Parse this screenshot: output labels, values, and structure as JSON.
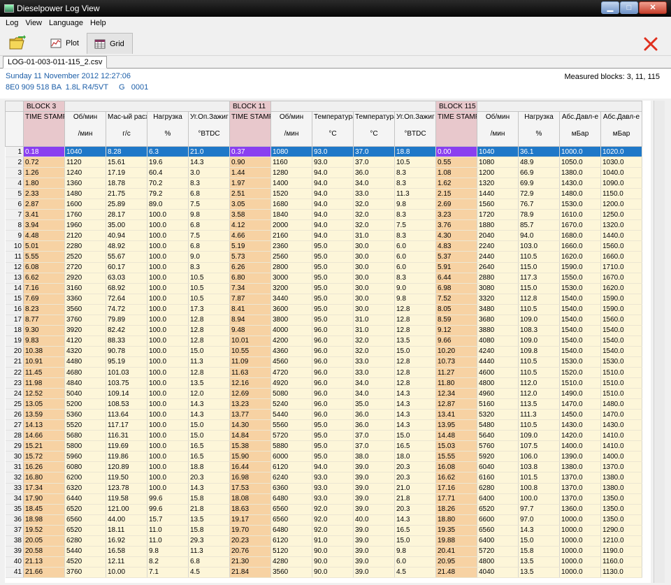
{
  "window": {
    "title": "Dieselpower Log View",
    "min": "▁",
    "max": "□",
    "close": "✕"
  },
  "menu": [
    "Log",
    "View",
    "Language",
    "Help"
  ],
  "toolbar": {
    "plot_label": "Plot",
    "grid_label": "Grid"
  },
  "file_tab": "LOG-01-003-011-115_2.csv",
  "info": {
    "date": "Sunday 11 November 2012 12:27:06",
    "ecu": "8E0 909 518 BA  1.8L R4/5VT     G   0001",
    "measured": "Measured blocks: 3, 11, 115"
  },
  "blocks": [
    {
      "label": "BLOCK 3",
      "span": 5
    },
    {
      "label": "BLOCK 11",
      "span": 5
    },
    {
      "label": "BLOCK 115",
      "span": 5
    }
  ],
  "columns": [
    {
      "name": "TIME STAMP",
      "unit": "",
      "ts": true
    },
    {
      "name": "Об/мин",
      "unit": "/мин"
    },
    {
      "name": "Мас-ый расход",
      "unit": "г/с"
    },
    {
      "name": "Нагрузка",
      "unit": "%"
    },
    {
      "name": "Уг.Оп.Зажиг",
      "unit": "°BTDC"
    },
    {
      "name": "TIME STAMP",
      "unit": "",
      "ts": true
    },
    {
      "name": "Об/мин",
      "unit": "/мин"
    },
    {
      "name": "Температура",
      "unit": "°C"
    },
    {
      "name": "Температура",
      "unit": "°C"
    },
    {
      "name": "Уг.Оп.Зажиг",
      "unit": "°BTDC"
    },
    {
      "name": "TIME STAMP",
      "unit": "",
      "ts": true
    },
    {
      "name": "Об/мин",
      "unit": "/мин"
    },
    {
      "name": "Нагрузка",
      "unit": "%"
    },
    {
      "name": "Абс.Давл-е",
      "unit": "мБар"
    },
    {
      "name": "Абс.Давл-е",
      "unit": "мБар"
    }
  ],
  "selected_row": 1,
  "rows": [
    [
      "1",
      "0.18",
      "1040",
      "8.28",
      "6.3",
      "21.0",
      "0.37",
      "1080",
      "93.0",
      "37.0",
      "18.8",
      "0.00",
      "1040",
      "36.1",
      "1000.0",
      "1020.0"
    ],
    [
      "2",
      "0.72",
      "1120",
      "15.61",
      "19.6",
      "14.3",
      "0.90",
      "1160",
      "93.0",
      "37.0",
      "10.5",
      "0.55",
      "1080",
      "48.9",
      "1050.0",
      "1030.0"
    ],
    [
      "3",
      "1.26",
      "1240",
      "17.19",
      "60.4",
      "3.0",
      "1.44",
      "1280",
      "94.0",
      "36.0",
      "8.3",
      "1.08",
      "1200",
      "66.9",
      "1380.0",
      "1040.0"
    ],
    [
      "4",
      "1.80",
      "1360",
      "18.78",
      "70.2",
      "8.3",
      "1.97",
      "1400",
      "94.0",
      "34.0",
      "8.3",
      "1.62",
      "1320",
      "69.9",
      "1430.0",
      "1090.0"
    ],
    [
      "5",
      "2.33",
      "1480",
      "21.75",
      "79.2",
      "6.8",
      "2.51",
      "1520",
      "94.0",
      "33.0",
      "11.3",
      "2.15",
      "1440",
      "72.9",
      "1480.0",
      "1150.0"
    ],
    [
      "6",
      "2.87",
      "1600",
      "25.89",
      "89.0",
      "7.5",
      "3.05",
      "1680",
      "94.0",
      "32.0",
      "9.8",
      "2.69",
      "1560",
      "76.7",
      "1530.0",
      "1200.0"
    ],
    [
      "7",
      "3.41",
      "1760",
      "28.17",
      "100.0",
      "9.8",
      "3.58",
      "1840",
      "94.0",
      "32.0",
      "8.3",
      "3.23",
      "1720",
      "78.9",
      "1610.0",
      "1250.0"
    ],
    [
      "8",
      "3.94",
      "1960",
      "35.00",
      "100.0",
      "6.8",
      "4.12",
      "2000",
      "94.0",
      "32.0",
      "7.5",
      "3.76",
      "1880",
      "85.7",
      "1670.0",
      "1320.0"
    ],
    [
      "9",
      "4.48",
      "2120",
      "40.94",
      "100.0",
      "7.5",
      "4.66",
      "2160",
      "94.0",
      "31.0",
      "8.3",
      "4.30",
      "2040",
      "94.0",
      "1680.0",
      "1440.0"
    ],
    [
      "10",
      "5.01",
      "2280",
      "48.92",
      "100.0",
      "6.8",
      "5.19",
      "2360",
      "95.0",
      "30.0",
      "6.0",
      "4.83",
      "2240",
      "103.0",
      "1660.0",
      "1560.0"
    ],
    [
      "11",
      "5.55",
      "2520",
      "55.67",
      "100.0",
      "9.0",
      "5.73",
      "2560",
      "95.0",
      "30.0",
      "6.0",
      "5.37",
      "2440",
      "110.5",
      "1620.0",
      "1660.0"
    ],
    [
      "12",
      "6.08",
      "2720",
      "60.17",
      "100.0",
      "8.3",
      "6.26",
      "2800",
      "95.0",
      "30.0",
      "6.0",
      "5.91",
      "2640",
      "115.0",
      "1590.0",
      "1710.0"
    ],
    [
      "13",
      "6.62",
      "2920",
      "63.03",
      "100.0",
      "10.5",
      "6.80",
      "3000",
      "95.0",
      "30.0",
      "8.3",
      "6.44",
      "2880",
      "117.3",
      "1550.0",
      "1670.0"
    ],
    [
      "14",
      "7.16",
      "3160",
      "68.92",
      "100.0",
      "10.5",
      "7.34",
      "3200",
      "95.0",
      "30.0",
      "9.0",
      "6.98",
      "3080",
      "115.0",
      "1530.0",
      "1620.0"
    ],
    [
      "15",
      "7.69",
      "3360",
      "72.64",
      "100.0",
      "10.5",
      "7.87",
      "3440",
      "95.0",
      "30.0",
      "9.8",
      "7.52",
      "3320",
      "112.8",
      "1540.0",
      "1590.0"
    ],
    [
      "16",
      "8.23",
      "3560",
      "74.72",
      "100.0",
      "17.3",
      "8.41",
      "3600",
      "95.0",
      "30.0",
      "12.8",
      "8.05",
      "3480",
      "110.5",
      "1540.0",
      "1590.0"
    ],
    [
      "17",
      "8.77",
      "3760",
      "79.89",
      "100.0",
      "12.8",
      "8.94",
      "3800",
      "95.0",
      "31.0",
      "12.8",
      "8.59",
      "3680",
      "109.0",
      "1540.0",
      "1560.0"
    ],
    [
      "18",
      "9.30",
      "3920",
      "82.42",
      "100.0",
      "12.8",
      "9.48",
      "4000",
      "96.0",
      "31.0",
      "12.8",
      "9.12",
      "3880",
      "108.3",
      "1540.0",
      "1540.0"
    ],
    [
      "19",
      "9.83",
      "4120",
      "88.33",
      "100.0",
      "12.8",
      "10.01",
      "4200",
      "96.0",
      "32.0",
      "13.5",
      "9.66",
      "4080",
      "109.0",
      "1540.0",
      "1540.0"
    ],
    [
      "20",
      "10.38",
      "4320",
      "90.78",
      "100.0",
      "15.0",
      "10.55",
      "4360",
      "96.0",
      "32.0",
      "15.0",
      "10.20",
      "4240",
      "109.8",
      "1540.0",
      "1540.0"
    ],
    [
      "21",
      "10.91",
      "4480",
      "95.19",
      "100.0",
      "11.3",
      "11.09",
      "4560",
      "96.0",
      "33.0",
      "12.8",
      "10.73",
      "4440",
      "110.5",
      "1530.0",
      "1530.0"
    ],
    [
      "22",
      "11.45",
      "4680",
      "101.03",
      "100.0",
      "12.8",
      "11.63",
      "4720",
      "96.0",
      "33.0",
      "12.8",
      "11.27",
      "4600",
      "110.5",
      "1520.0",
      "1510.0"
    ],
    [
      "23",
      "11.98",
      "4840",
      "103.75",
      "100.0",
      "13.5",
      "12.16",
      "4920",
      "96.0",
      "34.0",
      "12.8",
      "11.80",
      "4800",
      "112.0",
      "1510.0",
      "1510.0"
    ],
    [
      "24",
      "12.52",
      "5040",
      "109.14",
      "100.0",
      "12.0",
      "12.69",
      "5080",
      "96.0",
      "34.0",
      "14.3",
      "12.34",
      "4960",
      "112.0",
      "1490.0",
      "1510.0"
    ],
    [
      "25",
      "13.05",
      "5200",
      "108.53",
      "100.0",
      "14.3",
      "13.23",
      "5240",
      "96.0",
      "35.0",
      "14.3",
      "12.87",
      "5160",
      "113.5",
      "1470.0",
      "1480.0"
    ],
    [
      "26",
      "13.59",
      "5360",
      "113.64",
      "100.0",
      "14.3",
      "13.77",
      "5440",
      "96.0",
      "36.0",
      "14.3",
      "13.41",
      "5320",
      "111.3",
      "1450.0",
      "1470.0"
    ],
    [
      "27",
      "14.13",
      "5520",
      "117.17",
      "100.0",
      "15.0",
      "14.30",
      "5560",
      "95.0",
      "36.0",
      "14.3",
      "13.95",
      "5480",
      "110.5",
      "1430.0",
      "1430.0"
    ],
    [
      "28",
      "14.66",
      "5680",
      "116.31",
      "100.0",
      "15.0",
      "14.84",
      "5720",
      "95.0",
      "37.0",
      "15.0",
      "14.48",
      "5640",
      "109.0",
      "1420.0",
      "1410.0"
    ],
    [
      "29",
      "15.21",
      "5800",
      "119.69",
      "100.0",
      "16.5",
      "15.38",
      "5880",
      "95.0",
      "37.0",
      "16.5",
      "15.03",
      "5760",
      "107.5",
      "1400.0",
      "1410.0"
    ],
    [
      "30",
      "15.72",
      "5960",
      "119.86",
      "100.0",
      "16.5",
      "15.90",
      "6000",
      "95.0",
      "38.0",
      "18.0",
      "15.55",
      "5920",
      "106.0",
      "1390.0",
      "1400.0"
    ],
    [
      "31",
      "16.26",
      "6080",
      "120.89",
      "100.0",
      "18.8",
      "16.44",
      "6120",
      "94.0",
      "39.0",
      "20.3",
      "16.08",
      "6040",
      "103.8",
      "1380.0",
      "1370.0"
    ],
    [
      "32",
      "16.80",
      "6200",
      "119.50",
      "100.0",
      "20.3",
      "16.98",
      "6240",
      "93.0",
      "39.0",
      "20.3",
      "16.62",
      "6160",
      "101.5",
      "1370.0",
      "1380.0"
    ],
    [
      "33",
      "17.34",
      "6320",
      "123.78",
      "100.0",
      "14.3",
      "17.53",
      "6360",
      "93.0",
      "39.0",
      "21.0",
      "17.16",
      "6280",
      "100.8",
      "1370.0",
      "1380.0"
    ],
    [
      "34",
      "17.90",
      "6440",
      "119.58",
      "99.6",
      "15.8",
      "18.08",
      "6480",
      "93.0",
      "39.0",
      "21.8",
      "17.71",
      "6400",
      "100.0",
      "1370.0",
      "1350.0"
    ],
    [
      "35",
      "18.45",
      "6520",
      "121.00",
      "99.6",
      "21.8",
      "18.63",
      "6560",
      "92.0",
      "39.0",
      "20.3",
      "18.26",
      "6520",
      "97.7",
      "1360.0",
      "1350.0"
    ],
    [
      "36",
      "18.98",
      "6560",
      "44.00",
      "15.7",
      "13.5",
      "19.17",
      "6560",
      "92.0",
      "40.0",
      "14.3",
      "18.80",
      "6600",
      "97.0",
      "1000.0",
      "1350.0"
    ],
    [
      "37",
      "19.52",
      "6520",
      "18.11",
      "11.0",
      "15.8",
      "19.70",
      "6480",
      "92.0",
      "39.0",
      "16.5",
      "19.35",
      "6560",
      "14.3",
      "1000.0",
      "1290.0"
    ],
    [
      "38",
      "20.05",
      "6280",
      "16.92",
      "11.0",
      "29.3",
      "20.23",
      "6120",
      "91.0",
      "39.0",
      "15.0",
      "19.88",
      "6400",
      "15.0",
      "1000.0",
      "1210.0"
    ],
    [
      "39",
      "20.58",
      "5440",
      "16.58",
      "9.8",
      "11.3",
      "20.76",
      "5120",
      "90.0",
      "39.0",
      "9.8",
      "20.41",
      "5720",
      "15.8",
      "1000.0",
      "1190.0"
    ],
    [
      "40",
      "21.13",
      "4520",
      "12.11",
      "8.2",
      "6.8",
      "21.30",
      "4280",
      "90.0",
      "39.0",
      "6.0",
      "20.95",
      "4800",
      "13.5",
      "1000.0",
      "1160.0"
    ],
    [
      "41",
      "21.66",
      "3760",
      "10.00",
      "7.1",
      "4.5",
      "21.84",
      "3560",
      "90.0",
      "39.0",
      "4.5",
      "21.48",
      "4040",
      "13.5",
      "1000.0",
      "1130.0"
    ]
  ]
}
